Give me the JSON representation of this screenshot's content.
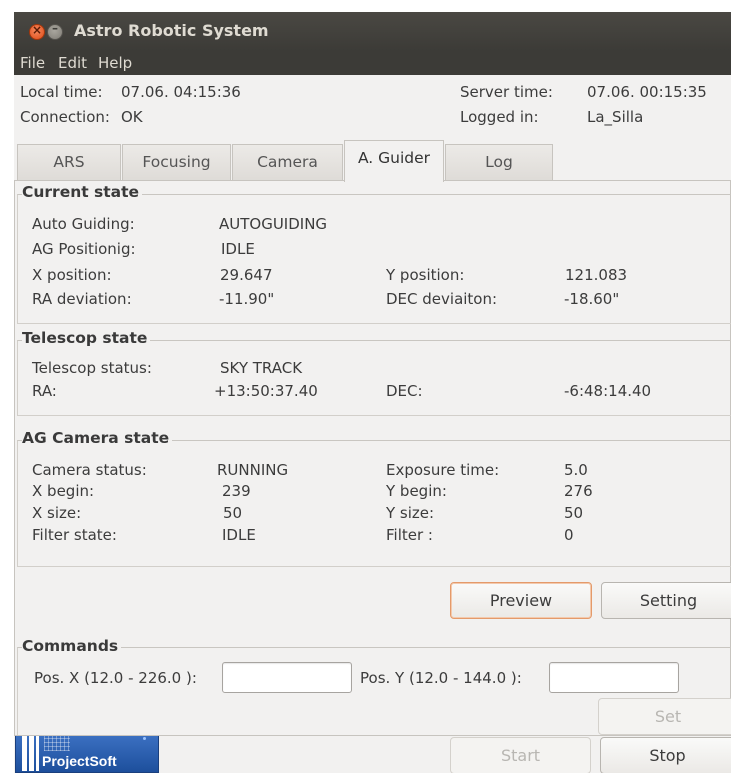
{
  "window": {
    "title": "Astro Robotic System"
  },
  "menu": {
    "file": "File",
    "edit": "Edit",
    "help": "Help"
  },
  "info": {
    "local_time_label": "Local time:",
    "local_time_value": "07.06. 04:15:36",
    "connection_label": "Connection:",
    "connection_value": "OK",
    "server_time_label": "Server time:",
    "server_time_value": "07.06. 00:15:35",
    "logged_in_label": "Logged in:",
    "logged_in_value": "La_Silla"
  },
  "tabs": [
    {
      "label": "ARS"
    },
    {
      "label": "Focusing"
    },
    {
      "label": "Camera"
    },
    {
      "label": "A. Guider"
    },
    {
      "label": "Log"
    }
  ],
  "current_state": {
    "title": "Current state",
    "auto_guiding_label": "Auto Guiding:",
    "auto_guiding_value": "AUTOGUIDING",
    "ag_positioning_label": "AG Positionig:",
    "ag_positioning_value": "IDLE",
    "x_position_label": "X position:",
    "x_position_value": "29.647",
    "y_position_label": "Y position:",
    "y_position_value": "121.083",
    "ra_deviation_label": "RA deviation:",
    "ra_deviation_value": "-11.90\"",
    "dec_deviation_label": "DEC deviaiton:",
    "dec_deviation_value": "-18.60\""
  },
  "telescope_state": {
    "title": "Telescop state",
    "status_label": "Telescop status:",
    "status_value": "SKY TRACK",
    "ra_label": "RA:",
    "ra_value": "+13:50:37.40",
    "dec_label": "DEC:",
    "dec_value": "-6:48:14.40"
  },
  "ag_camera_state": {
    "title": "AG Camera state",
    "camera_status_label": "Camera status:",
    "camera_status_value": "RUNNING",
    "exposure_time_label": "Exposure time:",
    "exposure_time_value": "5.0",
    "x_begin_label": "X begin:",
    "x_begin_value": "239",
    "y_begin_label": "Y begin:",
    "y_begin_value": "276",
    "x_size_label": "X size:",
    "x_size_value": "50",
    "y_size_label": "Y size:",
    "y_size_value": "50",
    "filter_state_label": "Filter state:",
    "filter_state_value": "IDLE",
    "filter_label": "Filter :",
    "filter_value": "0"
  },
  "buttons": {
    "preview": "Preview",
    "setting": "Setting",
    "set": "Set",
    "start": "Start",
    "stop": "Stop"
  },
  "commands": {
    "title": "Commands",
    "pos_x_label": "Pos. X (12.0 - 226.0 ):",
    "pos_x_value": "",
    "pos_y_label": "Pos. Y (12.0 - 144.0 ):",
    "pos_y_value": ""
  },
  "logo": {
    "text": "ProjectSoft"
  }
}
